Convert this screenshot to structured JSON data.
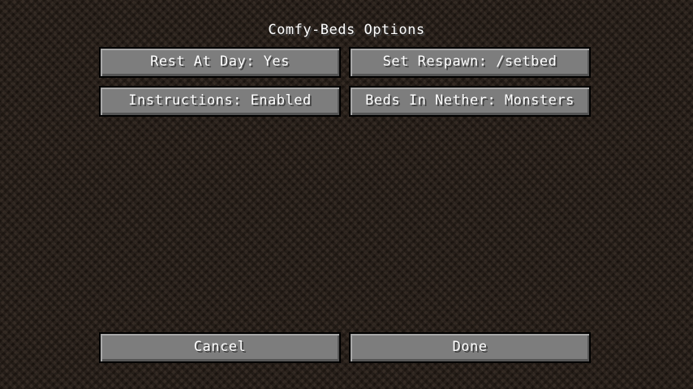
{
  "screen": {
    "title": "Comfy-Beds Options"
  },
  "options": [
    {
      "label": "Rest At Day: Yes"
    },
    {
      "label": "Set Respawn: /setbed"
    },
    {
      "label": "Instructions: Enabled"
    },
    {
      "label": "Beds In Nether: Monsters"
    }
  ],
  "footer": {
    "cancel_label": "Cancel",
    "done_label": "Done"
  },
  "colors": {
    "background": "#2b211a",
    "button_face": "#7d7d7d",
    "text": "#ffffff"
  }
}
